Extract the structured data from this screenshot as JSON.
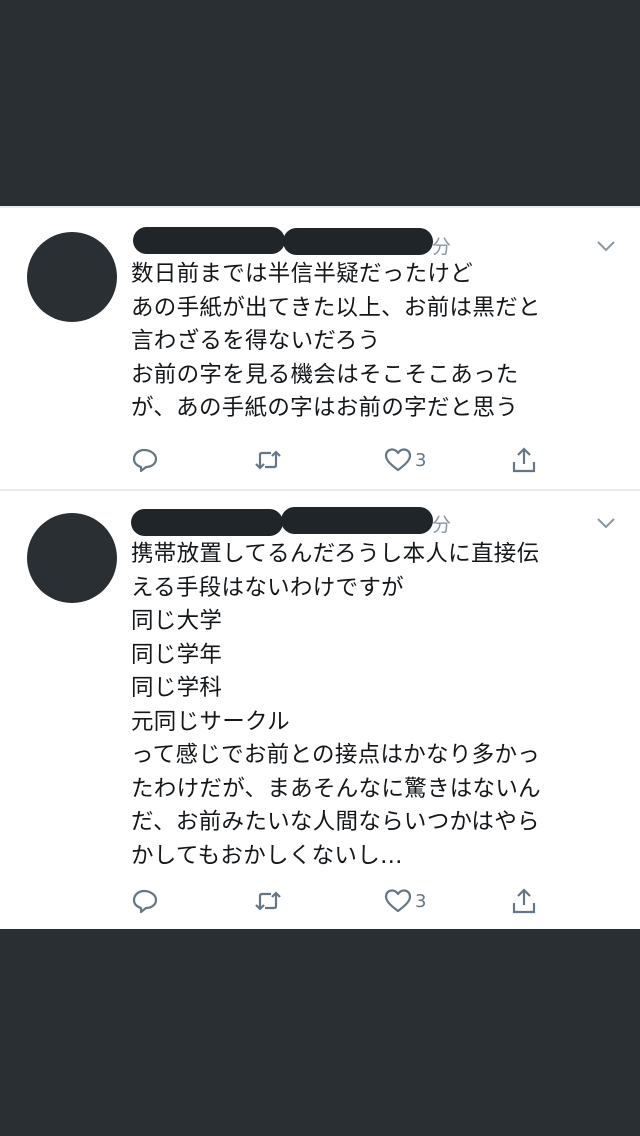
{
  "tweets": [
    {
      "time_suffix": "分",
      "lines": [
        "数日前までは半信半疑だったけど",
        "あの手紙が出てきた以上、お前は黒だと",
        "言わざるを得ないだろう",
        "お前の字を見る機会はそこそこあった",
        "が、あの手紙の字はお前の字だと思う"
      ],
      "like_count": "3"
    },
    {
      "time_suffix": "分",
      "lines": [
        "携帯放置してるんだろうし本人に直接伝",
        "える手段はないわけですが",
        "同じ大学",
        "同じ学年",
        "同じ学科",
        "元同じサークル",
        "って感じでお前との接点はかなり多かっ",
        "たわけだが、まあそんなに驚きはないん",
        "だ、お前みたいな人間ならいつかはやら",
        "かしてもおかしくないし…"
      ],
      "like_count": "3"
    }
  ],
  "icons": {
    "reply": "reply-icon",
    "retweet": "retweet-icon",
    "like": "heart-icon",
    "share": "share-icon",
    "more": "chevron-down-icon"
  },
  "colors": {
    "background": "#2a2f34",
    "card": "#ffffff",
    "text": "#14171a",
    "icon": "#657786",
    "redaction": "#20252a"
  }
}
